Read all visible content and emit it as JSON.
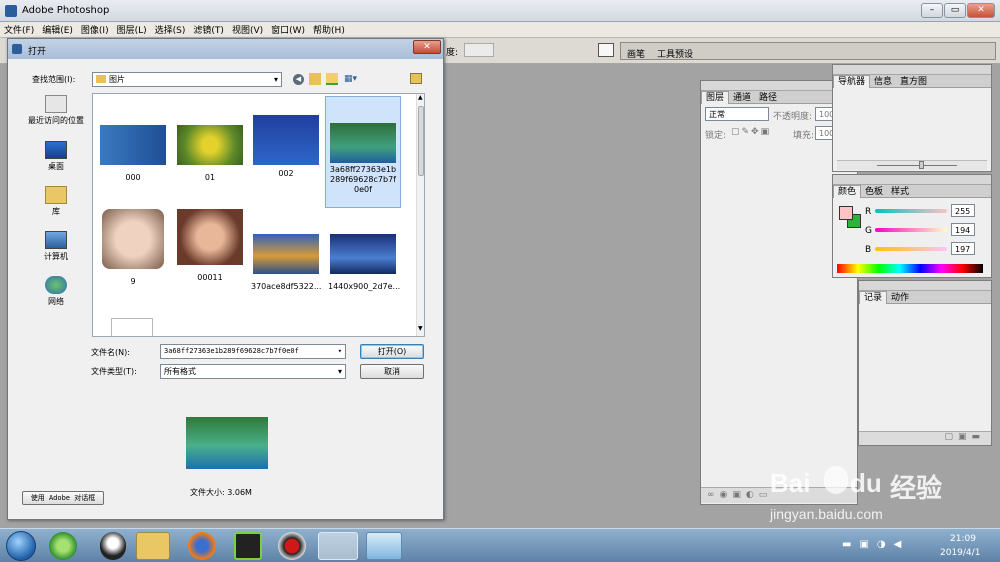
{
  "app": {
    "title": "Adobe Photoshop",
    "menu": [
      "文件(F)",
      "编辑(E)",
      "图像(I)",
      "图层(L)",
      "选择(S)",
      "滤镜(T)",
      "视图(V)",
      "窗口(W)",
      "帮助(H)"
    ],
    "opt_label": "度:",
    "opt_tabs": [
      "画笔",
      "工具预设"
    ]
  },
  "layers_panel": {
    "tabs": [
      "图层",
      "通道",
      "路径"
    ],
    "blend": "正常",
    "opacity_label": "不透明度:",
    "opacity": "100",
    "lock": "锁定:",
    "fill_label": "填充:",
    "fill": "100"
  },
  "nav_panel": {
    "tabs": [
      "导航器",
      "信息",
      "直方图"
    ]
  },
  "color_panel": {
    "tabs": [
      "颜色",
      "色板",
      "样式"
    ],
    "r_label": "R",
    "g_label": "G",
    "b_label": "B",
    "r": "255",
    "g": "194",
    "b": "197",
    "fg": "#ffc2c5",
    "bg": "#2db23a"
  },
  "history_panel": {
    "tabs": [
      "记录",
      "动作"
    ]
  },
  "dialog": {
    "title": "打开",
    "look_in_label": "查找范围(I):",
    "look_in": "图片",
    "places": [
      "最近访问的位置",
      "桌面",
      "库",
      "计算机",
      "网络"
    ],
    "files": [
      {
        "name": "000"
      },
      {
        "name": "01"
      },
      {
        "name": "002"
      },
      {
        "name": "3a68ff27363e1b289f69628c7b7f0e0f"
      },
      {
        "name": "9"
      },
      {
        "name": "00011"
      },
      {
        "name": "370ace8df5322..."
      },
      {
        "name": "1440x900_2d7e..."
      }
    ],
    "filename_label": "文件名(N):",
    "filename": "3a68ff27363e1b289f69628c7b7f0e0f",
    "filetype_label": "文件类型(T):",
    "filetype": "所有格式",
    "open_btn": "打开(O)",
    "cancel_btn": "取消",
    "filesize": "文件大小: 3.06M",
    "adobe_btn": "使用 Adobe 对话框"
  },
  "taskbar": {
    "time": "21:09",
    "date": "2019/4/1"
  },
  "watermark": {
    "brand": "Bai",
    "brand2": "du",
    "cn": "经验",
    "url": "jingyan.baidu.com"
  }
}
